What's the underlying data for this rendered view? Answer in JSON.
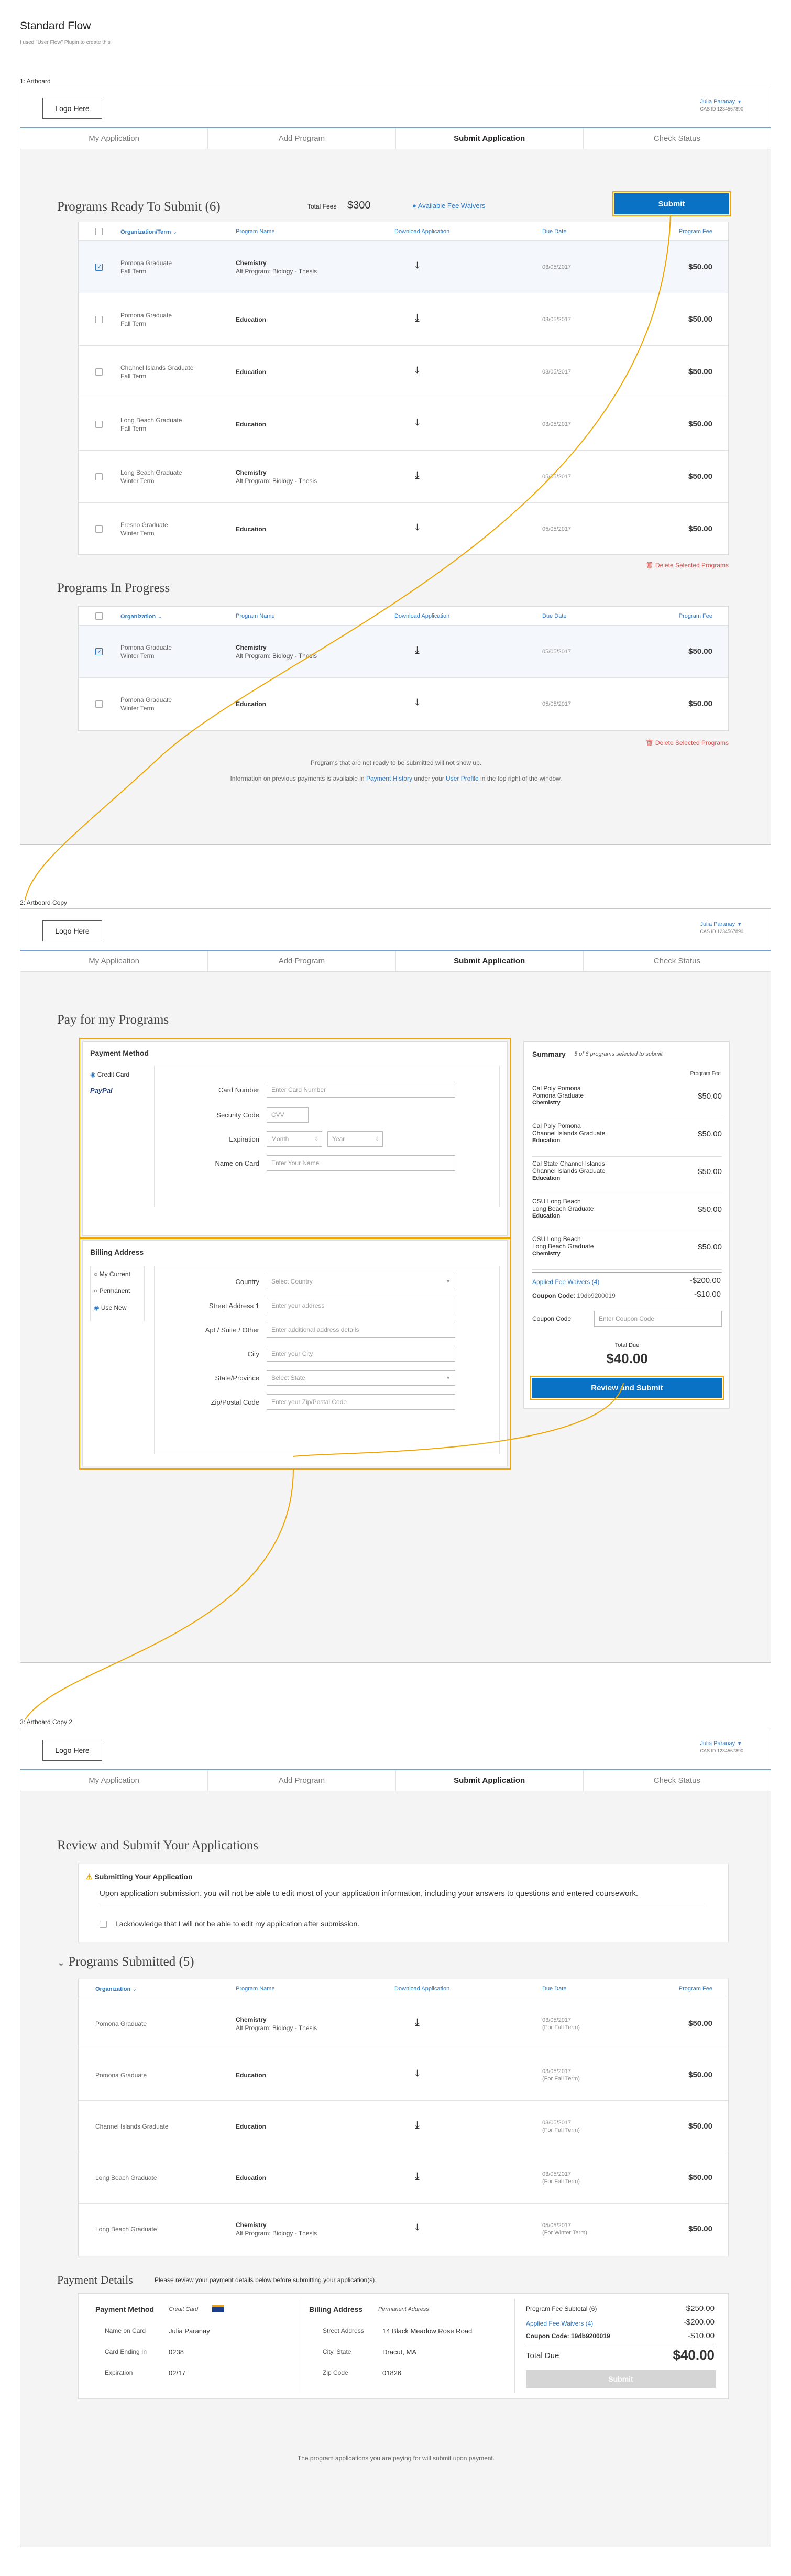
{
  "header": {
    "title": "Standard Flow",
    "subtitle": "I used \"User Flow\" Plugin to create this"
  },
  "artboards": [
    "1: Artboard",
    "2: Artboard Copy",
    "3: Artboard Copy 2"
  ],
  "common": {
    "logo": "Logo Here",
    "user_name": "Julia Paranay",
    "cas_id": "CAS ID 1234567890",
    "tabs": [
      "My Application",
      "Add Program",
      "Submit Application",
      "Check Status"
    ]
  },
  "a1": {
    "ready_title": "Programs Ready To Submit (6)",
    "total_fees_label": "Total Fees",
    "total_fees": "$300",
    "waivers": "Available Fee Waivers",
    "submit": "Submit",
    "columns": [
      "Organization/Term",
      "Program Name",
      "Download Application",
      "Due Date",
      "Program Fee"
    ],
    "rows": [
      {
        "org": "Pomona Graduate",
        "term": "Fall Term",
        "prog": "Chemistry",
        "sub": "Alt Program: Biology - Thesis",
        "due": "03/05/2017",
        "fee": "$50.00"
      },
      {
        "org": "Pomona Graduate",
        "term": "Fall Term",
        "prog": "Education",
        "sub": "",
        "due": "03/05/2017",
        "fee": "$50.00"
      },
      {
        "org": "Channel Islands Graduate",
        "term": "Fall Term",
        "prog": "Education",
        "sub": "",
        "due": "03/05/2017",
        "fee": "$50.00"
      },
      {
        "org": "Long Beach Graduate",
        "term": "Fall Term",
        "prog": "Education",
        "sub": "",
        "due": "03/05/2017",
        "fee": "$50.00"
      },
      {
        "org": "Long Beach Graduate",
        "term": "Winter Term",
        "prog": "Chemistry",
        "sub": "Alt Program: Biology - Thesis",
        "due": "05/05/2017",
        "fee": "$50.00"
      },
      {
        "org": "Fresno Graduate",
        "term": "Winter Term",
        "prog": "Education",
        "sub": "",
        "due": "05/05/2017",
        "fee": "$50.00"
      }
    ],
    "delete": "Delete Selected Programs",
    "progress_title": "Programs In Progress",
    "progress_columns": [
      "Organization",
      "Program Name",
      "Download Application",
      "Due Date",
      "Program Fee"
    ],
    "progress_rows": [
      {
        "org": "Pomona Graduate",
        "term": "Winter Term",
        "prog": "Chemistry",
        "sub": "Alt Program: Biology - Thesis",
        "due": "05/05/2017",
        "fee": "$50.00"
      },
      {
        "org": "Pomona Graduate",
        "term": "Winter Term",
        "prog": "Education",
        "sub": "",
        "due": "05/05/2017",
        "fee": "$50.00"
      }
    ],
    "note1": "Programs that are not ready to be submitted will not show up.",
    "note2a": "Information on previous payments is available in",
    "note2b": "Payment History",
    "note2c": "under your",
    "note2d": "User Profile",
    "note2e": "in the top right of the window."
  },
  "a2": {
    "title": "Pay for my Programs",
    "payment_method": "Payment Method",
    "credit_card": "Credit Card",
    "paypal": "PayPal",
    "card_number": "Card Number",
    "card_number_ph": "Enter Card Number",
    "security_code": "Security Code",
    "cvv": "CVV",
    "expiration": "Expiration",
    "month": "Month",
    "year": "Year",
    "name_on_card": "Name on Card",
    "name_ph": "Enter Your Name",
    "billing": "Billing Address",
    "my_current": "My Current",
    "permanent": "Permanent",
    "use_new": "Use New",
    "country": "Country",
    "country_ph": "Select Country",
    "street": "Street Address 1",
    "street_ph": "Enter your address",
    "apt": "Apt / Suite / Other",
    "apt_ph": "Enter additional address details",
    "city": "City",
    "city_ph": "Enter your City",
    "state": "State/Province",
    "state_ph": "Select State",
    "zip": "Zip/Postal Code",
    "zip_ph": "Enter your Zip/Postal Code",
    "summary": "Summary",
    "summary_sub": "5 of 6 programs selected to submit",
    "program_fee": "Program Fee",
    "items": [
      {
        "l1": "Cal Poly Pomona",
        "l2": "Pomona Graduate",
        "l3": "Chemistry",
        "fee": "$50.00"
      },
      {
        "l1": "Cal Poly Pomona",
        "l2": "Channel Islands Graduate",
        "l3": "Education",
        "fee": "$50.00"
      },
      {
        "l1": "Cal State Channel Islands",
        "l2": "Channel Islands Graduate",
        "l3": "Education",
        "fee": "$50.00"
      },
      {
        "l1": "CSU Long Beach",
        "l2": "Long Beach Graduate",
        "l3": "Education",
        "fee": "$50.00"
      },
      {
        "l1": "CSU Long Beach",
        "l2": "Long Beach Graduate",
        "l3": "Chemistry",
        "fee": "$50.00"
      }
    ],
    "applied": "Applied Fee Waivers (4)",
    "applied_amt": "-$200.00",
    "coupon_code_label": "Coupon Code",
    "coupon_code": "19db9200019",
    "coupon_amt": "-$10.00",
    "coupon_field_label": "Coupon Code",
    "coupon_ph": "Enter Coupon Code",
    "total_due": "Total Due",
    "total": "$40.00",
    "review": "Review and Submit"
  },
  "a3": {
    "title": "Review and Submit Your Applications",
    "warn_title": "Submitting Your Application",
    "warn_text": "Upon application submission, you will not be able to edit most of your application information, including your answers to questions and entered coursework.",
    "ack": "I acknowledge that I will not be able to edit my application after submission.",
    "submitted_title": "Programs Submitted (5)",
    "columns": [
      "Organization",
      "Program Name",
      "Download Application",
      "Due Date",
      "Program Fee"
    ],
    "rows": [
      {
        "org": "Pomona Graduate",
        "prog": "Chemistry",
        "sub": "Alt Program: Biology - Thesis",
        "due": "03/05/2017",
        "term": "(For Fall Term)",
        "fee": "$50.00"
      },
      {
        "org": "Pomona Graduate",
        "prog": "Education",
        "sub": "",
        "due": "03/05/2017",
        "term": "(For Fall Term)",
        "fee": "$50.00"
      },
      {
        "org": "Channel Islands Graduate",
        "prog": "Education",
        "sub": "",
        "due": "03/05/2017",
        "term": "(For Fall Term)",
        "fee": "$50.00"
      },
      {
        "org": "Long Beach Graduate",
        "prog": "Education",
        "sub": "",
        "due": "03/05/2017",
        "term": "(For Fall Term)",
        "fee": "$50.00"
      },
      {
        "org": "Long Beach Graduate",
        "prog": "Chemistry",
        "sub": "Alt Program: Biology - Thesis",
        "due": "05/05/2017",
        "term": "(For Winter Term)",
        "fee": "$50.00"
      }
    ],
    "payment_details": "Payment Details",
    "payment_sub": "Please review your payment details below before submitting your application(s).",
    "pm": "Payment Method",
    "pm_val": "Credit Card",
    "name_label": "Name on Card",
    "name_val": "Julia Paranay",
    "ending_label": "Card Ending In",
    "ending_val": "0238",
    "exp_label": "Expiration",
    "exp_val": "02/17",
    "ba": "Billing Address",
    "ba_val": "Permanent Address",
    "street_label": "Street Address",
    "street_val": "14 Black Meadow Rose Road",
    "city_label": "City, State",
    "city_val": "Dracut, MA",
    "zip_label": "Zip Code",
    "zip_val": "01826",
    "subtotal_label": "Program Fee Subtotal (6)",
    "subtotal": "$250.00",
    "waivers_label": "Applied Fee Waivers (4)",
    "waivers": "-$200.00",
    "coupon_label": "Coupon Code: 19db9200019",
    "coupon": "-$10.00",
    "total_label": "Total Due",
    "total": "$40.00",
    "submit": "Submit",
    "footer": "The program applications you are paying for will submit upon payment."
  },
  "colors": {
    "accent": "#0a72c5",
    "highlight": "#f0a500",
    "link": "#2f7ac4",
    "danger": "#d9534f"
  }
}
